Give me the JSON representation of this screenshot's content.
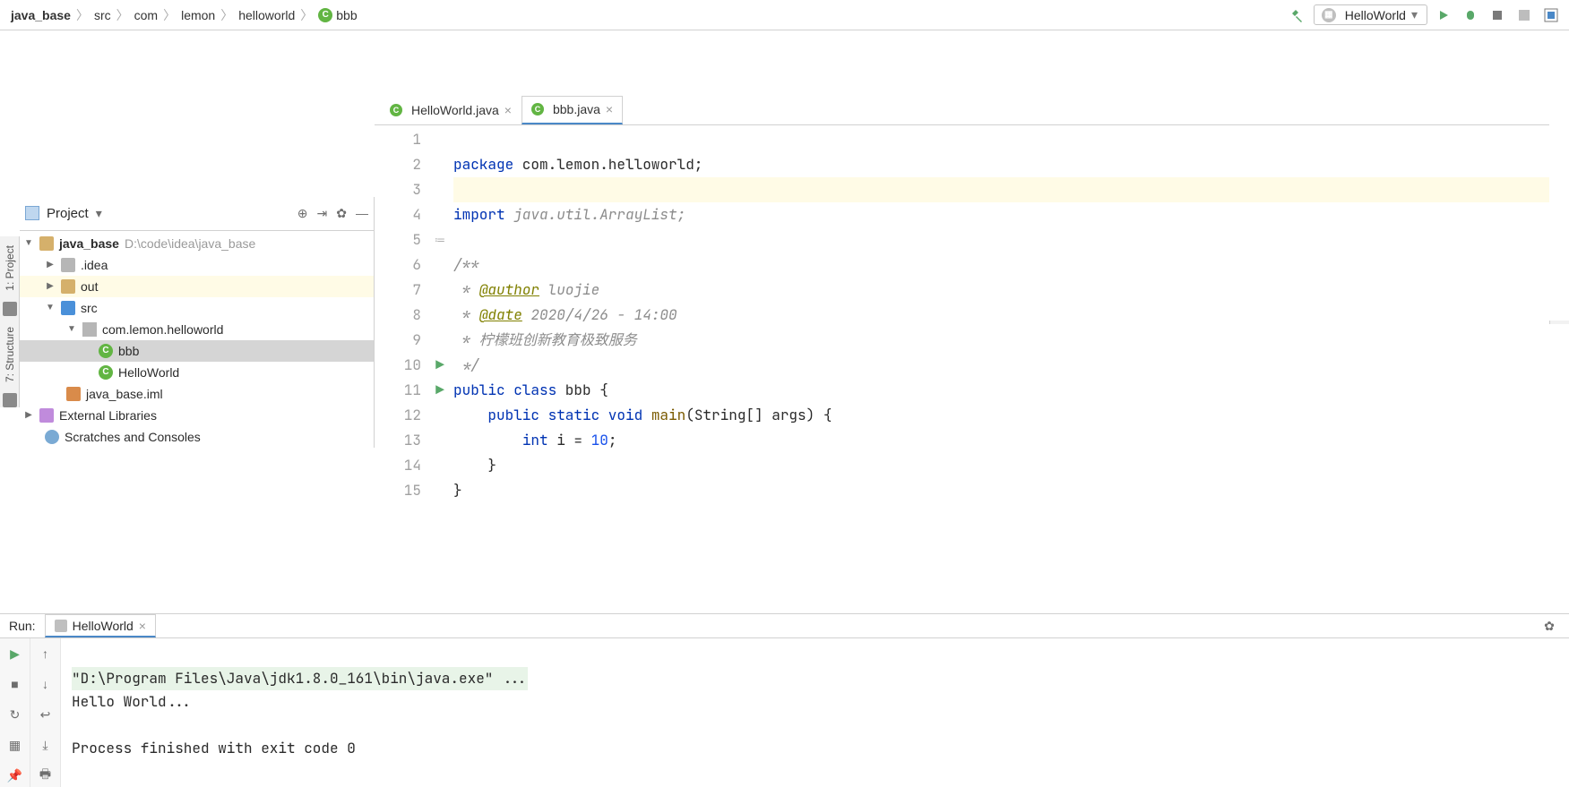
{
  "breadcrumbs": [
    "java_base",
    "src",
    "com",
    "lemon",
    "helloworld",
    "bbb"
  ],
  "run_config": {
    "label": "HelloWorld"
  },
  "left_stripe": {
    "project": "1: Project",
    "structure": "7: Structure"
  },
  "project_panel": {
    "title": "Project",
    "root": {
      "name": "java_base",
      "path": "D:\\code\\idea\\java_base"
    },
    "nodes": {
      "idea": ".idea",
      "out": "out",
      "src": "src",
      "pkg": "com.lemon.helloworld",
      "bbb": "bbb",
      "hello": "HelloWorld",
      "iml": "java_base.iml",
      "ext": "External Libraries",
      "scratch": "Scratches and Consoles"
    }
  },
  "tabs": [
    {
      "name": "HelloWorld.java"
    },
    {
      "name": "bbb.java"
    }
  ],
  "code": {
    "l1a": "package",
    "l1b": " com.lemon.helloworld;",
    "l3a": "import",
    "l3b": " java.util.ArrayList;",
    "l5": "/**",
    "l6a": " * ",
    "l6b": "@author",
    "l6c": " luojie",
    "l7a": " * ",
    "l7b": "@date",
    "l7c": " 2020/4/26 - 14:00",
    "l8": " * 柠檬班创新教育极致服务",
    "l9": " */",
    "l10a": "public class",
    "l10b": " bbb {",
    "l11a": "    ",
    "l11b": "public static void",
    "l11c": " ",
    "l11d": "main",
    "l11e": "(String[] args) {",
    "l12a": "        ",
    "l12b": "int",
    "l12c": " i = ",
    "l12d": "10",
    "l12e": ";",
    "l13": "    }",
    "l14": "}"
  },
  "gutter_lines": [
    "1",
    "2",
    "3",
    "4",
    "5",
    "6",
    "7",
    "8",
    "9",
    "10",
    "11",
    "12",
    "13",
    "14",
    "15"
  ],
  "run": {
    "label": "Run:",
    "tab": "HelloWorld",
    "cmd": "\"D:\\Program Files\\Java\\jdk1.8.0_161\\bin\\java.exe\" ...",
    "out1": "Hello World...",
    "out2": "Process finished with exit code 0"
  }
}
